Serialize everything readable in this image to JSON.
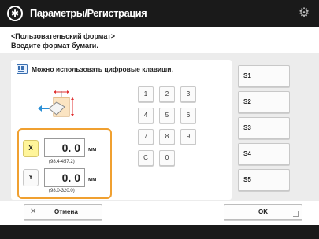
{
  "header": {
    "title": "Параметры/Регистрация"
  },
  "subheader": {
    "line1": "<Пользовательский формат>",
    "line2": "Введите формат бумаги."
  },
  "hint": {
    "text": "Можно использовать цифровые клавиши."
  },
  "keypad": {
    "keys": [
      "1",
      "2",
      "3",
      "4",
      "5",
      "6",
      "7",
      "8",
      "9",
      "C",
      "0"
    ]
  },
  "inputs": {
    "x": {
      "axis_label": "X",
      "value": "0. 0",
      "unit": "мм",
      "range": "(98.4-457.2)"
    },
    "y": {
      "axis_label": "Y",
      "value": "0. 0",
      "unit": "мм",
      "range": "(98.0-320.0)"
    }
  },
  "saved_sizes": [
    "S1",
    "S2",
    "S3",
    "S4",
    "S5"
  ],
  "footer": {
    "cancel_label": "Отмена",
    "ok_label": "OK"
  },
  "colors": {
    "header_bg": "#1a1a1a",
    "highlight_border": "#f0a030",
    "selected_axis": "#fff59a"
  }
}
